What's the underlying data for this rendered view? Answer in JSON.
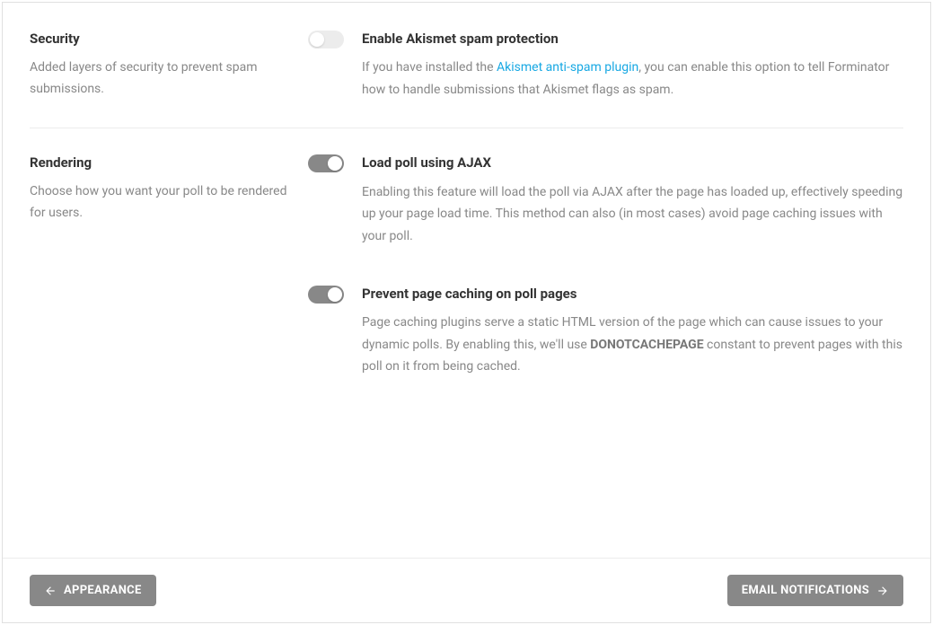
{
  "sections": {
    "security": {
      "title": "Security",
      "desc": "Added layers of security to prevent spam submissions.",
      "settings": {
        "akismet": {
          "title": "Enable Akismet spam protection",
          "desc_pre": "If you have installed the ",
          "link_text": "Akismet anti-spam plugin",
          "desc_post": ", you can enable this option to tell Forminator how to handle submissions that Akismet flags as spam."
        }
      }
    },
    "rendering": {
      "title": "Rendering",
      "desc": "Choose how you want your poll to be rendered for users.",
      "settings": {
        "ajax": {
          "title": "Load poll using AJAX",
          "desc": "Enabling this feature will load the poll via AJAX after the page has loaded up, effectively speeding up your page load time. This method can also (in most cases) avoid page caching issues with your poll."
        },
        "cache": {
          "title": "Prevent page caching on poll pages",
          "desc_pre": "Page caching plugins serve a static HTML version of the page which can cause issues to your dynamic polls. By enabling this, we'll use ",
          "bold_text": "DONOTCACHEPAGE",
          "desc_post": " constant to prevent pages with this poll on it from being cached."
        }
      }
    }
  },
  "footer": {
    "prev_label": "APPEARANCE",
    "next_label": "EMAIL NOTIFICATIONS"
  }
}
